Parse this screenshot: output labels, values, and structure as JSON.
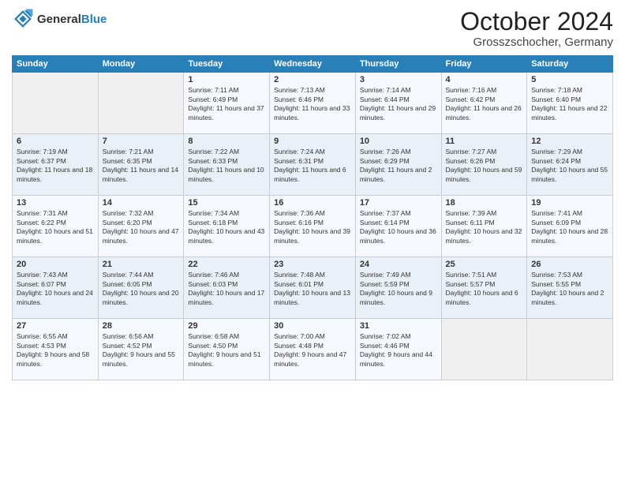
{
  "logo": {
    "general": "General",
    "blue": "Blue"
  },
  "header": {
    "title": "October 2024",
    "location": "Grosszschocher, Germany"
  },
  "weekdays": [
    "Sunday",
    "Monday",
    "Tuesday",
    "Wednesday",
    "Thursday",
    "Friday",
    "Saturday"
  ],
  "weeks": [
    [
      {
        "day": "",
        "info": ""
      },
      {
        "day": "",
        "info": ""
      },
      {
        "day": "1",
        "info": "Sunrise: 7:11 AM\nSunset: 6:49 PM\nDaylight: 11 hours and 37 minutes."
      },
      {
        "day": "2",
        "info": "Sunrise: 7:13 AM\nSunset: 6:46 PM\nDaylight: 11 hours and 33 minutes."
      },
      {
        "day": "3",
        "info": "Sunrise: 7:14 AM\nSunset: 6:44 PM\nDaylight: 11 hours and 29 minutes."
      },
      {
        "day": "4",
        "info": "Sunrise: 7:16 AM\nSunset: 6:42 PM\nDaylight: 11 hours and 26 minutes."
      },
      {
        "day": "5",
        "info": "Sunrise: 7:18 AM\nSunset: 6:40 PM\nDaylight: 11 hours and 22 minutes."
      }
    ],
    [
      {
        "day": "6",
        "info": "Sunrise: 7:19 AM\nSunset: 6:37 PM\nDaylight: 11 hours and 18 minutes."
      },
      {
        "day": "7",
        "info": "Sunrise: 7:21 AM\nSunset: 6:35 PM\nDaylight: 11 hours and 14 minutes."
      },
      {
        "day": "8",
        "info": "Sunrise: 7:22 AM\nSunset: 6:33 PM\nDaylight: 11 hours and 10 minutes."
      },
      {
        "day": "9",
        "info": "Sunrise: 7:24 AM\nSunset: 6:31 PM\nDaylight: 11 hours and 6 minutes."
      },
      {
        "day": "10",
        "info": "Sunrise: 7:26 AM\nSunset: 6:29 PM\nDaylight: 11 hours and 2 minutes."
      },
      {
        "day": "11",
        "info": "Sunrise: 7:27 AM\nSunset: 6:26 PM\nDaylight: 10 hours and 59 minutes."
      },
      {
        "day": "12",
        "info": "Sunrise: 7:29 AM\nSunset: 6:24 PM\nDaylight: 10 hours and 55 minutes."
      }
    ],
    [
      {
        "day": "13",
        "info": "Sunrise: 7:31 AM\nSunset: 6:22 PM\nDaylight: 10 hours and 51 minutes."
      },
      {
        "day": "14",
        "info": "Sunrise: 7:32 AM\nSunset: 6:20 PM\nDaylight: 10 hours and 47 minutes."
      },
      {
        "day": "15",
        "info": "Sunrise: 7:34 AM\nSunset: 6:18 PM\nDaylight: 10 hours and 43 minutes."
      },
      {
        "day": "16",
        "info": "Sunrise: 7:36 AM\nSunset: 6:16 PM\nDaylight: 10 hours and 39 minutes."
      },
      {
        "day": "17",
        "info": "Sunrise: 7:37 AM\nSunset: 6:14 PM\nDaylight: 10 hours and 36 minutes."
      },
      {
        "day": "18",
        "info": "Sunrise: 7:39 AM\nSunset: 6:11 PM\nDaylight: 10 hours and 32 minutes."
      },
      {
        "day": "19",
        "info": "Sunrise: 7:41 AM\nSunset: 6:09 PM\nDaylight: 10 hours and 28 minutes."
      }
    ],
    [
      {
        "day": "20",
        "info": "Sunrise: 7:43 AM\nSunset: 6:07 PM\nDaylight: 10 hours and 24 minutes."
      },
      {
        "day": "21",
        "info": "Sunrise: 7:44 AM\nSunset: 6:05 PM\nDaylight: 10 hours and 20 minutes."
      },
      {
        "day": "22",
        "info": "Sunrise: 7:46 AM\nSunset: 6:03 PM\nDaylight: 10 hours and 17 minutes."
      },
      {
        "day": "23",
        "info": "Sunrise: 7:48 AM\nSunset: 6:01 PM\nDaylight: 10 hours and 13 minutes."
      },
      {
        "day": "24",
        "info": "Sunrise: 7:49 AM\nSunset: 5:59 PM\nDaylight: 10 hours and 9 minutes."
      },
      {
        "day": "25",
        "info": "Sunrise: 7:51 AM\nSunset: 5:57 PM\nDaylight: 10 hours and 6 minutes."
      },
      {
        "day": "26",
        "info": "Sunrise: 7:53 AM\nSunset: 5:55 PM\nDaylight: 10 hours and 2 minutes."
      }
    ],
    [
      {
        "day": "27",
        "info": "Sunrise: 6:55 AM\nSunset: 4:53 PM\nDaylight: 9 hours and 58 minutes."
      },
      {
        "day": "28",
        "info": "Sunrise: 6:56 AM\nSunset: 4:52 PM\nDaylight: 9 hours and 55 minutes."
      },
      {
        "day": "29",
        "info": "Sunrise: 6:58 AM\nSunset: 4:50 PM\nDaylight: 9 hours and 51 minutes."
      },
      {
        "day": "30",
        "info": "Sunrise: 7:00 AM\nSunset: 4:48 PM\nDaylight: 9 hours and 47 minutes."
      },
      {
        "day": "31",
        "info": "Sunrise: 7:02 AM\nSunset: 4:46 PM\nDaylight: 9 hours and 44 minutes."
      },
      {
        "day": "",
        "info": ""
      },
      {
        "day": "",
        "info": ""
      }
    ]
  ]
}
